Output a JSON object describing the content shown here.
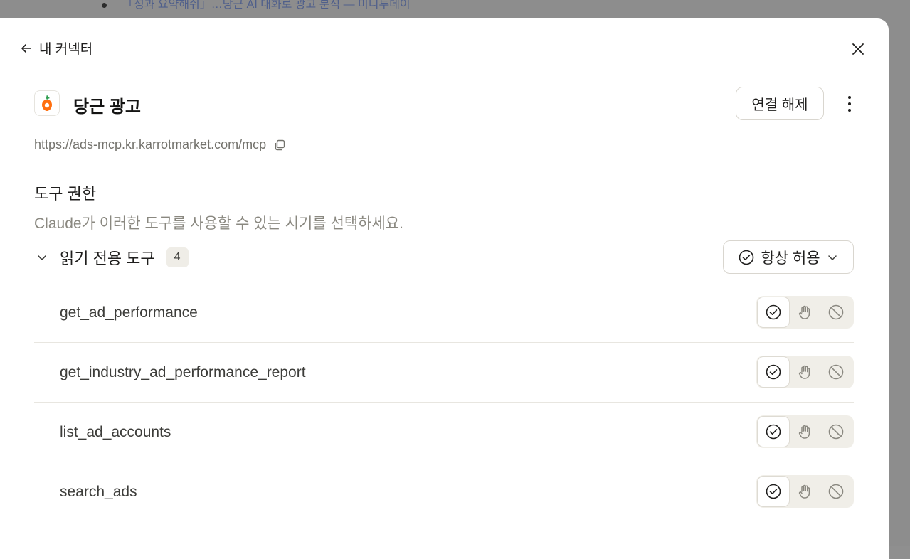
{
  "background": {
    "link_text": "「성과 요약해줘」…당근 AI 대화로 광고 분석 — 미니투데이"
  },
  "header": {
    "back_label": "내 커넥터"
  },
  "connector": {
    "name": "당근 광고",
    "url": "https://ads-mcp.kr.karrotmarket.com/mcp",
    "disconnect_label": "연결 해제",
    "brand_color": "#ff6f0f"
  },
  "permissions": {
    "title": "도구 권한",
    "description": "Claude가 이러한 도구를 사용할 수 있는 시기를 선택하세요.",
    "group": {
      "label": "읽기 전용 도구",
      "count": "4",
      "policy": "항상 허용"
    },
    "tools": [
      {
        "name": "get_ad_performance",
        "mode": "always-allow"
      },
      {
        "name": "get_industry_ad_performance_report",
        "mode": "always-allow"
      },
      {
        "name": "list_ad_accounts",
        "mode": "always-allow"
      },
      {
        "name": "search_ads",
        "mode": "always-allow"
      }
    ]
  },
  "icons": {
    "back": "arrow-left-icon",
    "close": "close-icon",
    "more": "more-vertical-icon",
    "copy": "copy-icon",
    "collapse": "chevron-down-icon",
    "allow": "check-circle-icon",
    "ask": "hand-icon",
    "block": "block-icon"
  }
}
